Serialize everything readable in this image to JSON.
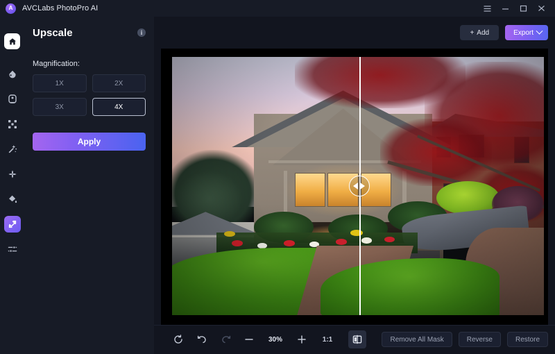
{
  "window": {
    "app_title": "AVCLabs PhotoPro AI",
    "logo_glyph": "A",
    "controls": [
      {
        "name": "menu-button",
        "icon": "hamburger-icon"
      },
      {
        "name": "minimize-button",
        "icon": "minimize-icon"
      },
      {
        "name": "maximize-button",
        "icon": "maximize-icon"
      },
      {
        "name": "close-button",
        "icon": "close-icon"
      }
    ]
  },
  "rail": {
    "home_icon": "home-icon",
    "items": [
      {
        "icon": "color-drop-icon",
        "active": false
      },
      {
        "icon": "portrait-retouch-icon",
        "active": false
      },
      {
        "icon": "background-remove-icon",
        "active": false
      },
      {
        "icon": "magic-wand-icon",
        "active": false
      },
      {
        "icon": "enhance-sparkle-icon",
        "active": false
      },
      {
        "icon": "paint-bucket-icon",
        "active": false
      },
      {
        "icon": "upscale-expand-icon",
        "active": true
      },
      {
        "icon": "adjust-sliders-icon",
        "active": false
      }
    ]
  },
  "panel": {
    "title": "Upscale",
    "info_glyph": "i",
    "magnification_label": "Magnification:",
    "magnification_options": [
      {
        "label": "1X",
        "selected": false
      },
      {
        "label": "2X",
        "selected": false
      },
      {
        "label": "3X",
        "selected": false
      },
      {
        "label": "4X",
        "selected": true
      }
    ],
    "apply_label": "Apply"
  },
  "topbar": {
    "add_label": "Add",
    "add_plus": "+",
    "export_label": "Export",
    "export_chevron": "chevron-down-icon"
  },
  "canvas": {
    "split_handle": "compare-split-handle",
    "image_alt": "house-at-dusk-photo"
  },
  "bottombar": {
    "tools": [
      {
        "name": "reset-button",
        "icon": "refresh-icon",
        "enabled": true
      },
      {
        "name": "undo-button",
        "icon": "undo-icon",
        "enabled": true
      },
      {
        "name": "redo-button",
        "icon": "redo-icon",
        "enabled": false
      },
      {
        "name": "zoom-out-button",
        "icon": "minus-icon",
        "enabled": true
      }
    ],
    "zoom_value": "30%",
    "zoom_in_icon": "plus-icon",
    "actual_size_label": "1:1",
    "compare_view_icon": "split-compare-icon",
    "remove_all_mask_label": "Remove All Mask",
    "reverse_label": "Reverse",
    "restore_label": "Restore"
  },
  "colors": {
    "panel_bg": "#171b26",
    "canvas_bg": "#000000",
    "accent_gradient_from": "#a465f0",
    "accent_gradient_to": "#4a63f0",
    "selected_border": "#b9c0d0"
  }
}
